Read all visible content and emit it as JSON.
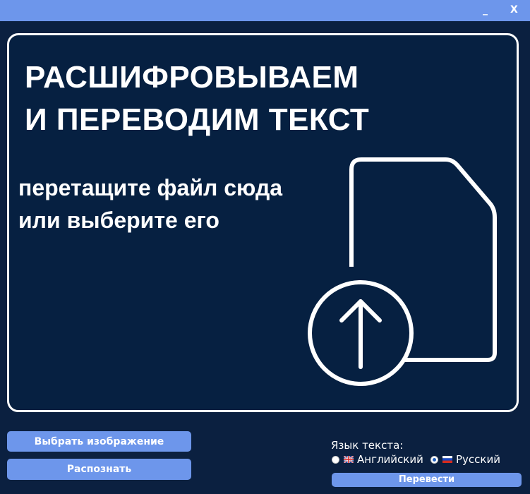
{
  "window": {
    "minimize_label": "_",
    "close_label": "X"
  },
  "dropzone": {
    "headline_line1": "РАСШИФРОВЫВАЕМ",
    "headline_line2": "И ПЕРЕВОДИМ ТЕКСТ",
    "instruction_line1": "перетащите файл сюда",
    "instruction_line2": "или выберите его",
    "icon": "file-upload-icon"
  },
  "actions": {
    "choose_image_label": "Выбрать изображение",
    "recognize_label": "Распознать",
    "translate_label": "Перевести"
  },
  "language": {
    "label": "Язык текста:",
    "options": [
      {
        "label": "Английский",
        "flag": "uk-flag-icon",
        "selected": false
      },
      {
        "label": "Русский",
        "flag": "russia-flag-icon",
        "selected": true
      }
    ]
  },
  "colors": {
    "titlebar": "#6d96eb",
    "background": "#0b2040",
    "dropzone": "#062041",
    "button": "#6d96eb"
  }
}
